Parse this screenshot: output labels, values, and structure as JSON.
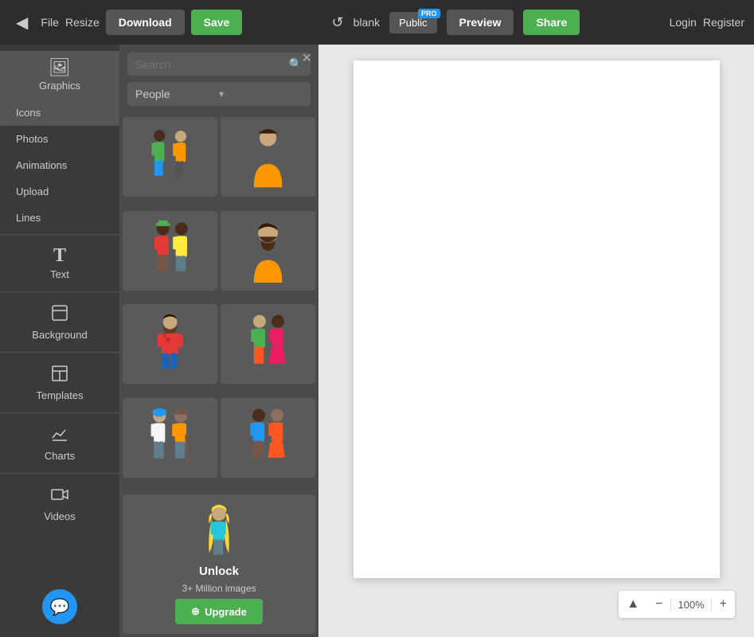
{
  "toolbar": {
    "back_icon": "◀",
    "file_label": "File",
    "resize_label": "Resize",
    "download_label": "Download",
    "save_label": "Save",
    "undo_icon": "↺",
    "blank_label": "blank",
    "public_label": "Public",
    "pro_badge": "PRO",
    "preview_label": "Preview",
    "share_label": "Share",
    "login_label": "Login",
    "register_label": "Register"
  },
  "sidebar": {
    "graphics_label": "Graphics",
    "graphics_icon": "🖼",
    "icons_label": "Icons",
    "photos_label": "Photos",
    "animations_label": "Animations",
    "upload_label": "Upload",
    "lines_label": "Lines",
    "text_label": "Text",
    "text_icon": "T",
    "background_label": "Background",
    "background_icon": "📄",
    "templates_label": "Templates",
    "templates_icon": "⊟",
    "charts_label": "Charts",
    "charts_icon": "📊",
    "videos_label": "Videos",
    "videos_icon": "🎬",
    "chat_icon": "💬"
  },
  "graphics_panel": {
    "search_placeholder": "Search",
    "search_icon": "🔍",
    "category": "People",
    "category_arrow": "▾",
    "close_icon": "✕"
  },
  "unlock": {
    "title": "Unlock",
    "subtitle": "3+ Million images",
    "upgrade_icon": "⊕",
    "upgrade_label": "Upgrade"
  },
  "zoom": {
    "up_icon": "▲",
    "minus_icon": "−",
    "value": "100%",
    "plus_icon": "+"
  }
}
